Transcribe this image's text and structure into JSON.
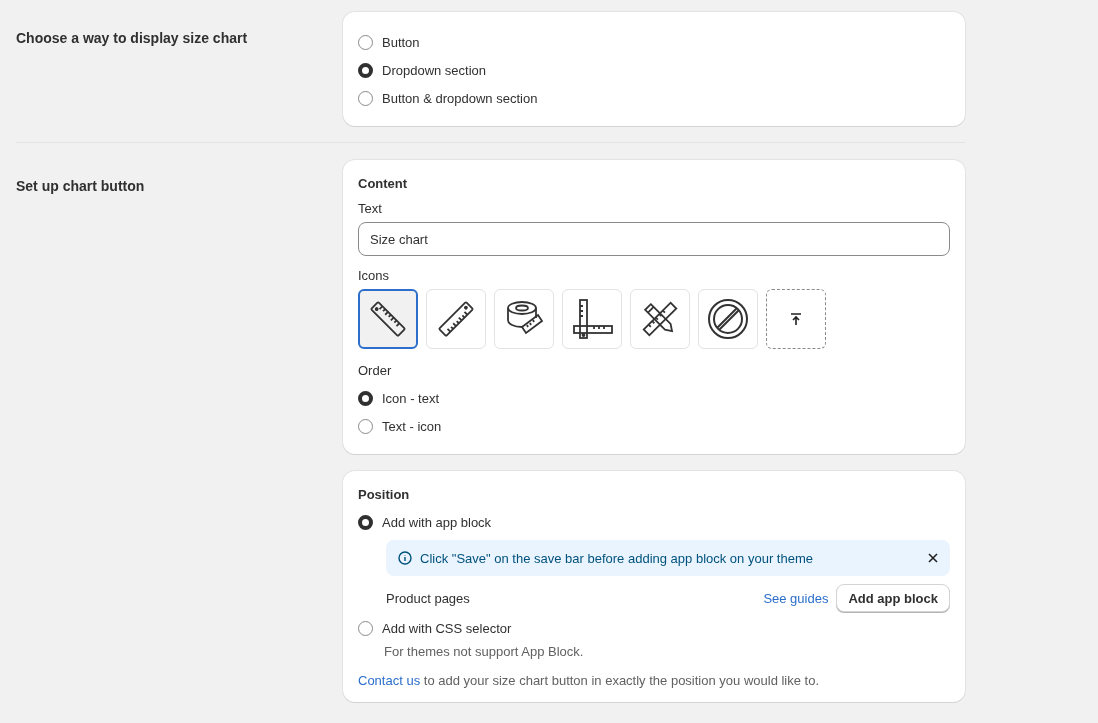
{
  "display_section": {
    "label": "Choose a way to display size chart",
    "options": [
      {
        "label": "Button",
        "selected": false
      },
      {
        "label": "Dropdown section",
        "selected": true
      },
      {
        "label": "Button & dropdown section",
        "selected": false
      }
    ]
  },
  "button_section": {
    "label": "Set up chart button",
    "content": {
      "heading": "Content",
      "text_label": "Text",
      "text_value": "Size chart",
      "icons_label": "Icons",
      "icons": [
        {
          "kind": "ruler",
          "selected": true
        },
        {
          "kind": "ruler-alt",
          "selected": false
        },
        {
          "kind": "tape",
          "selected": false
        },
        {
          "kind": "square",
          "selected": false
        },
        {
          "kind": "pencil-ruler",
          "selected": false
        },
        {
          "kind": "none",
          "selected": false
        },
        {
          "kind": "upload",
          "selected": false
        }
      ],
      "order_label": "Order",
      "order_options": [
        {
          "label": "Icon - text",
          "selected": true
        },
        {
          "label": "Text - icon",
          "selected": false
        }
      ]
    },
    "position": {
      "heading": "Position",
      "app_block": {
        "label": "Add with app block",
        "selected": true,
        "banner": "Click \"Save\" on the save bar before adding app block on your theme",
        "page_label": "Product pages",
        "guides_link": "See guides",
        "add_button": "Add app block"
      },
      "css_selector": {
        "label": "Add with CSS selector",
        "selected": false,
        "hint": "For themes not support App Block."
      },
      "note": {
        "link": "Contact us",
        "text": "to add your size chart button in exactly the position you would like to."
      }
    }
  }
}
